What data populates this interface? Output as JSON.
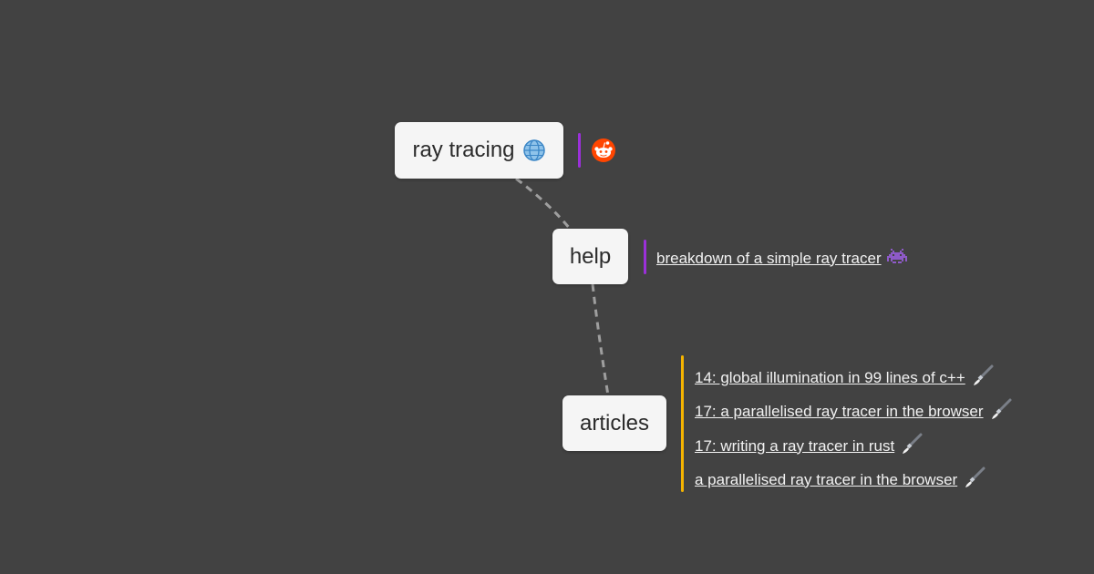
{
  "nodes": {
    "root": {
      "label": "ray tracing"
    },
    "help": {
      "label": "help"
    },
    "articles": {
      "label": "articles"
    }
  },
  "icons": {
    "root_icon": "globe-icon",
    "root_leaf": "reddit-icon",
    "help_link_icon": "space-invader-icon",
    "article_link_icon": "paintbrush-icon"
  },
  "help_links": [
    {
      "label": "breakdown of a simple ray tracer"
    }
  ],
  "article_links": [
    {
      "label": "14: global illumination in 99 lines of c++"
    },
    {
      "label": "17: a parallelised ray tracer in the browser"
    },
    {
      "label": "17: writing a ray tracer in rust"
    },
    {
      "label": "a parallelised ray tracer in the browser"
    }
  ],
  "colors": {
    "background": "#424242",
    "node_fill": "#f5f5f5",
    "connector": "#9e9e9e",
    "root_branch_accent": "#9b30d9",
    "help_branch_accent": "#9b30d9",
    "articles_branch_accent": "#f5b400",
    "reddit": "#ff4500"
  }
}
